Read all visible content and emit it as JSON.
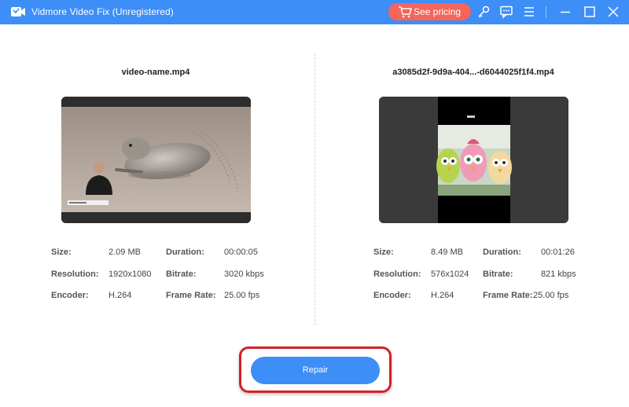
{
  "app": {
    "title": "Vidmore Video Fix (Unregistered)",
    "accent": "#3d8ef7",
    "pricing_color": "#f5655a"
  },
  "toolbar": {
    "pricing_label": "See pricing",
    "icons": [
      "cart-icon",
      "key-icon",
      "feedback-icon",
      "menu-icon",
      "minimize-icon",
      "maximize-icon",
      "close-icon"
    ]
  },
  "left": {
    "file_name": "video-name.mp4",
    "info": {
      "size_label": "Size:",
      "size": "2.09 MB",
      "duration_label": "Duration:",
      "duration": "00:00:05",
      "resolution_label": "Resolution:",
      "resolution": "1920x1080",
      "bitrate_label": "Bitrate:",
      "bitrate": "3020 kbps",
      "encoder_label": "Encoder:",
      "encoder": "H.264",
      "framerate_label": "Frame Rate:",
      "framerate": "25.00 fps"
    }
  },
  "right": {
    "file_name": "a3085d2f-9d9a-404...-d6044025f1f4.mp4",
    "info": {
      "size_label": "Size:",
      "size": "8.49 MB",
      "duration_label": "Duration:",
      "duration": "00:01:26",
      "resolution_label": "Resolution:",
      "resolution": "576x1024",
      "bitrate_label": "Bitrate:",
      "bitrate": "821 kbps",
      "encoder_label": "Encoder:",
      "encoder": "H.264",
      "framerate_label": "Frame Rate:",
      "framerate": "25.00 fps"
    }
  },
  "actions": {
    "repair_label": "Repair",
    "highlight_color": "#d61f26"
  }
}
